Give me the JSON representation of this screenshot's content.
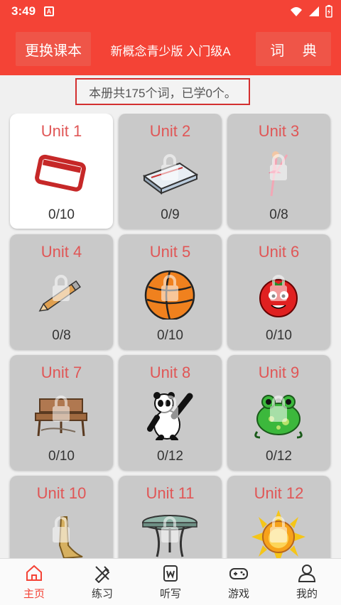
{
  "status": {
    "time": "3:49",
    "notif_letter": "A"
  },
  "appbar": {
    "change_book": "更换课本",
    "title": "新概念青少版 入门级A",
    "dictionary": "词 典"
  },
  "summary": "本册共175个词，已学0个。",
  "units": [
    {
      "name": "Unit 1",
      "progress": "0/10",
      "icon": "name-tag-icon"
    },
    {
      "name": "Unit 2",
      "progress": "0/9",
      "icon": "pencil-case-icon"
    },
    {
      "name": "Unit 3",
      "progress": "0/8",
      "icon": "ballerina-icon"
    },
    {
      "name": "Unit 4",
      "progress": "0/8",
      "icon": "pencil-icon"
    },
    {
      "name": "Unit 5",
      "progress": "0/10",
      "icon": "volleyball-icon"
    },
    {
      "name": "Unit 6",
      "progress": "0/10",
      "icon": "tomato-icon"
    },
    {
      "name": "Unit 7",
      "progress": "0/10",
      "icon": "bench-icon"
    },
    {
      "name": "Unit 8",
      "progress": "0/12",
      "icon": "panda-icon"
    },
    {
      "name": "Unit 9",
      "progress": "0/12",
      "icon": "frog-icon"
    },
    {
      "name": "Unit 10",
      "progress": "",
      "icon": "shoe-icon"
    },
    {
      "name": "Unit 11",
      "progress": "",
      "icon": "table-icon"
    },
    {
      "name": "Unit 12",
      "progress": "",
      "icon": "sun-icon"
    }
  ],
  "nav": [
    {
      "label": "主页",
      "icon": "home-icon"
    },
    {
      "label": "练习",
      "icon": "practice-icon"
    },
    {
      "label": "听写",
      "icon": "dictation-icon"
    },
    {
      "label": "游戏",
      "icon": "gamepad-icon"
    },
    {
      "label": "我的",
      "icon": "profile-icon"
    }
  ],
  "colors": {
    "accent": "#f44336",
    "unit_title": "#e05656",
    "locked_card": "#c9c9c9"
  }
}
